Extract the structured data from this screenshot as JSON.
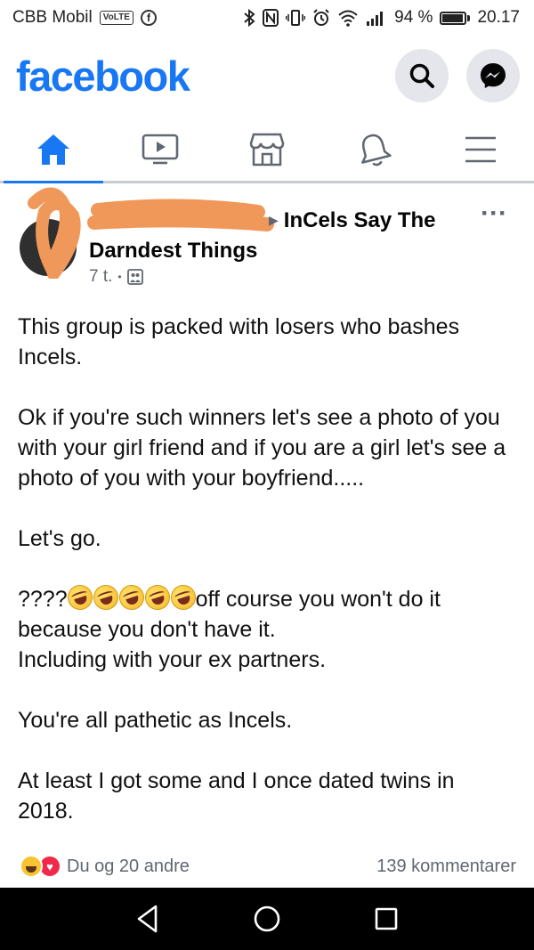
{
  "status_bar": {
    "carrier": "CBB Mobil",
    "volte": "VoLTE",
    "fb_badge": "f",
    "left_icons": [
      "facebook-notification-icon"
    ],
    "right_icons": [
      "bluetooth-icon",
      "nfc-icon",
      "vibrate-icon",
      "alarm-icon",
      "wifi-icon",
      "signal-icon"
    ],
    "battery_percent_text": "94 %",
    "battery_level": 0.94,
    "time": "20.17"
  },
  "header": {
    "logo": "facebook",
    "icons": [
      "search-icon",
      "messenger-icon"
    ]
  },
  "nav_tabs": [
    {
      "icon": "home-icon",
      "active": true
    },
    {
      "icon": "watch-icon",
      "active": false
    },
    {
      "icon": "marketplace-icon",
      "active": false
    },
    {
      "icon": "bell-icon",
      "active": false
    },
    {
      "icon": "menu-icon",
      "active": false
    }
  ],
  "post": {
    "group_name": "InCels Say The Darndest Things",
    "time": "7 t.",
    "privacy_icon": "group-icon",
    "paragraphs": {
      "p1": "This group is packed with losers who bashes Incels.",
      "p2": "Ok if you're such winners let's see a photo of you with your girl friend and if you are a girl let's see a photo of you with your boyfriend.....",
      "p3": "Let's go.",
      "p4_prefix": "????",
      "p4_suffix": "off course you won't do it because you don't have it.",
      "p4_line3": "Including with your ex partners.",
      "p5": "You're all pathetic as Incels.",
      "p6": "At least I got some and I once dated twins in 2018."
    },
    "laugh_emoji_count": 5
  },
  "reactions": {
    "icons": [
      "haha-icon",
      "love-icon"
    ],
    "text": "Du og 20 andre",
    "comments": "139 kommentarer"
  },
  "android_nav": [
    "back-icon",
    "home-circle-icon",
    "recents-icon"
  ],
  "colors": {
    "brand": "#1877f2",
    "redaction": "#f0985a"
  }
}
